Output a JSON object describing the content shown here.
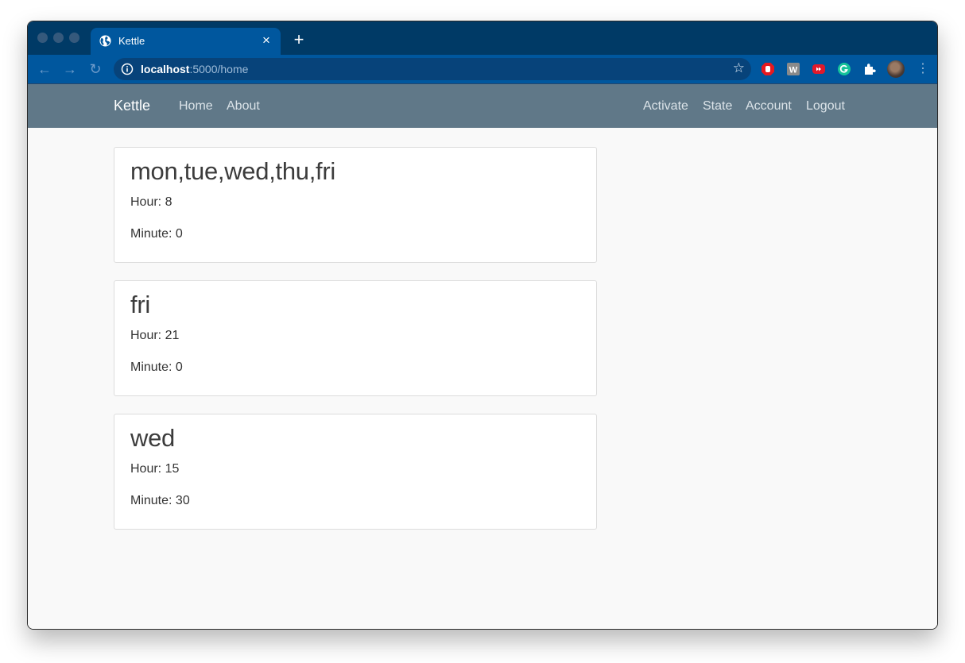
{
  "browser": {
    "tab": {
      "title": "Kettle",
      "icon": "globe-icon",
      "close_label": "×"
    },
    "new_tab_label": "+",
    "address": {
      "host": "localhost",
      "rest": ":5000/home"
    },
    "extensions": [
      "stop-hand-icon",
      "w-extension-icon",
      "fast-forward-icon",
      "grammarly-icon",
      "puzzle-icon"
    ],
    "colors": {
      "tabstrip": "#003a66",
      "toolbar": "#00579e",
      "omnibox": "#07437a"
    }
  },
  "navbar": {
    "brand": "Kettle",
    "left_links": [
      "Home",
      "About"
    ],
    "right_links": [
      "Activate",
      "State",
      "Account",
      "Logout"
    ],
    "color": "#607888"
  },
  "schedules": [
    {
      "days": "mon,tue,wed,thu,fri",
      "hour": "Hour: 8",
      "minute": "Minute: 0"
    },
    {
      "days": "fri",
      "hour": "Hour: 21",
      "minute": "Minute: 0"
    },
    {
      "days": "wed",
      "hour": "Hour: 15",
      "minute": "Minute: 30"
    }
  ]
}
